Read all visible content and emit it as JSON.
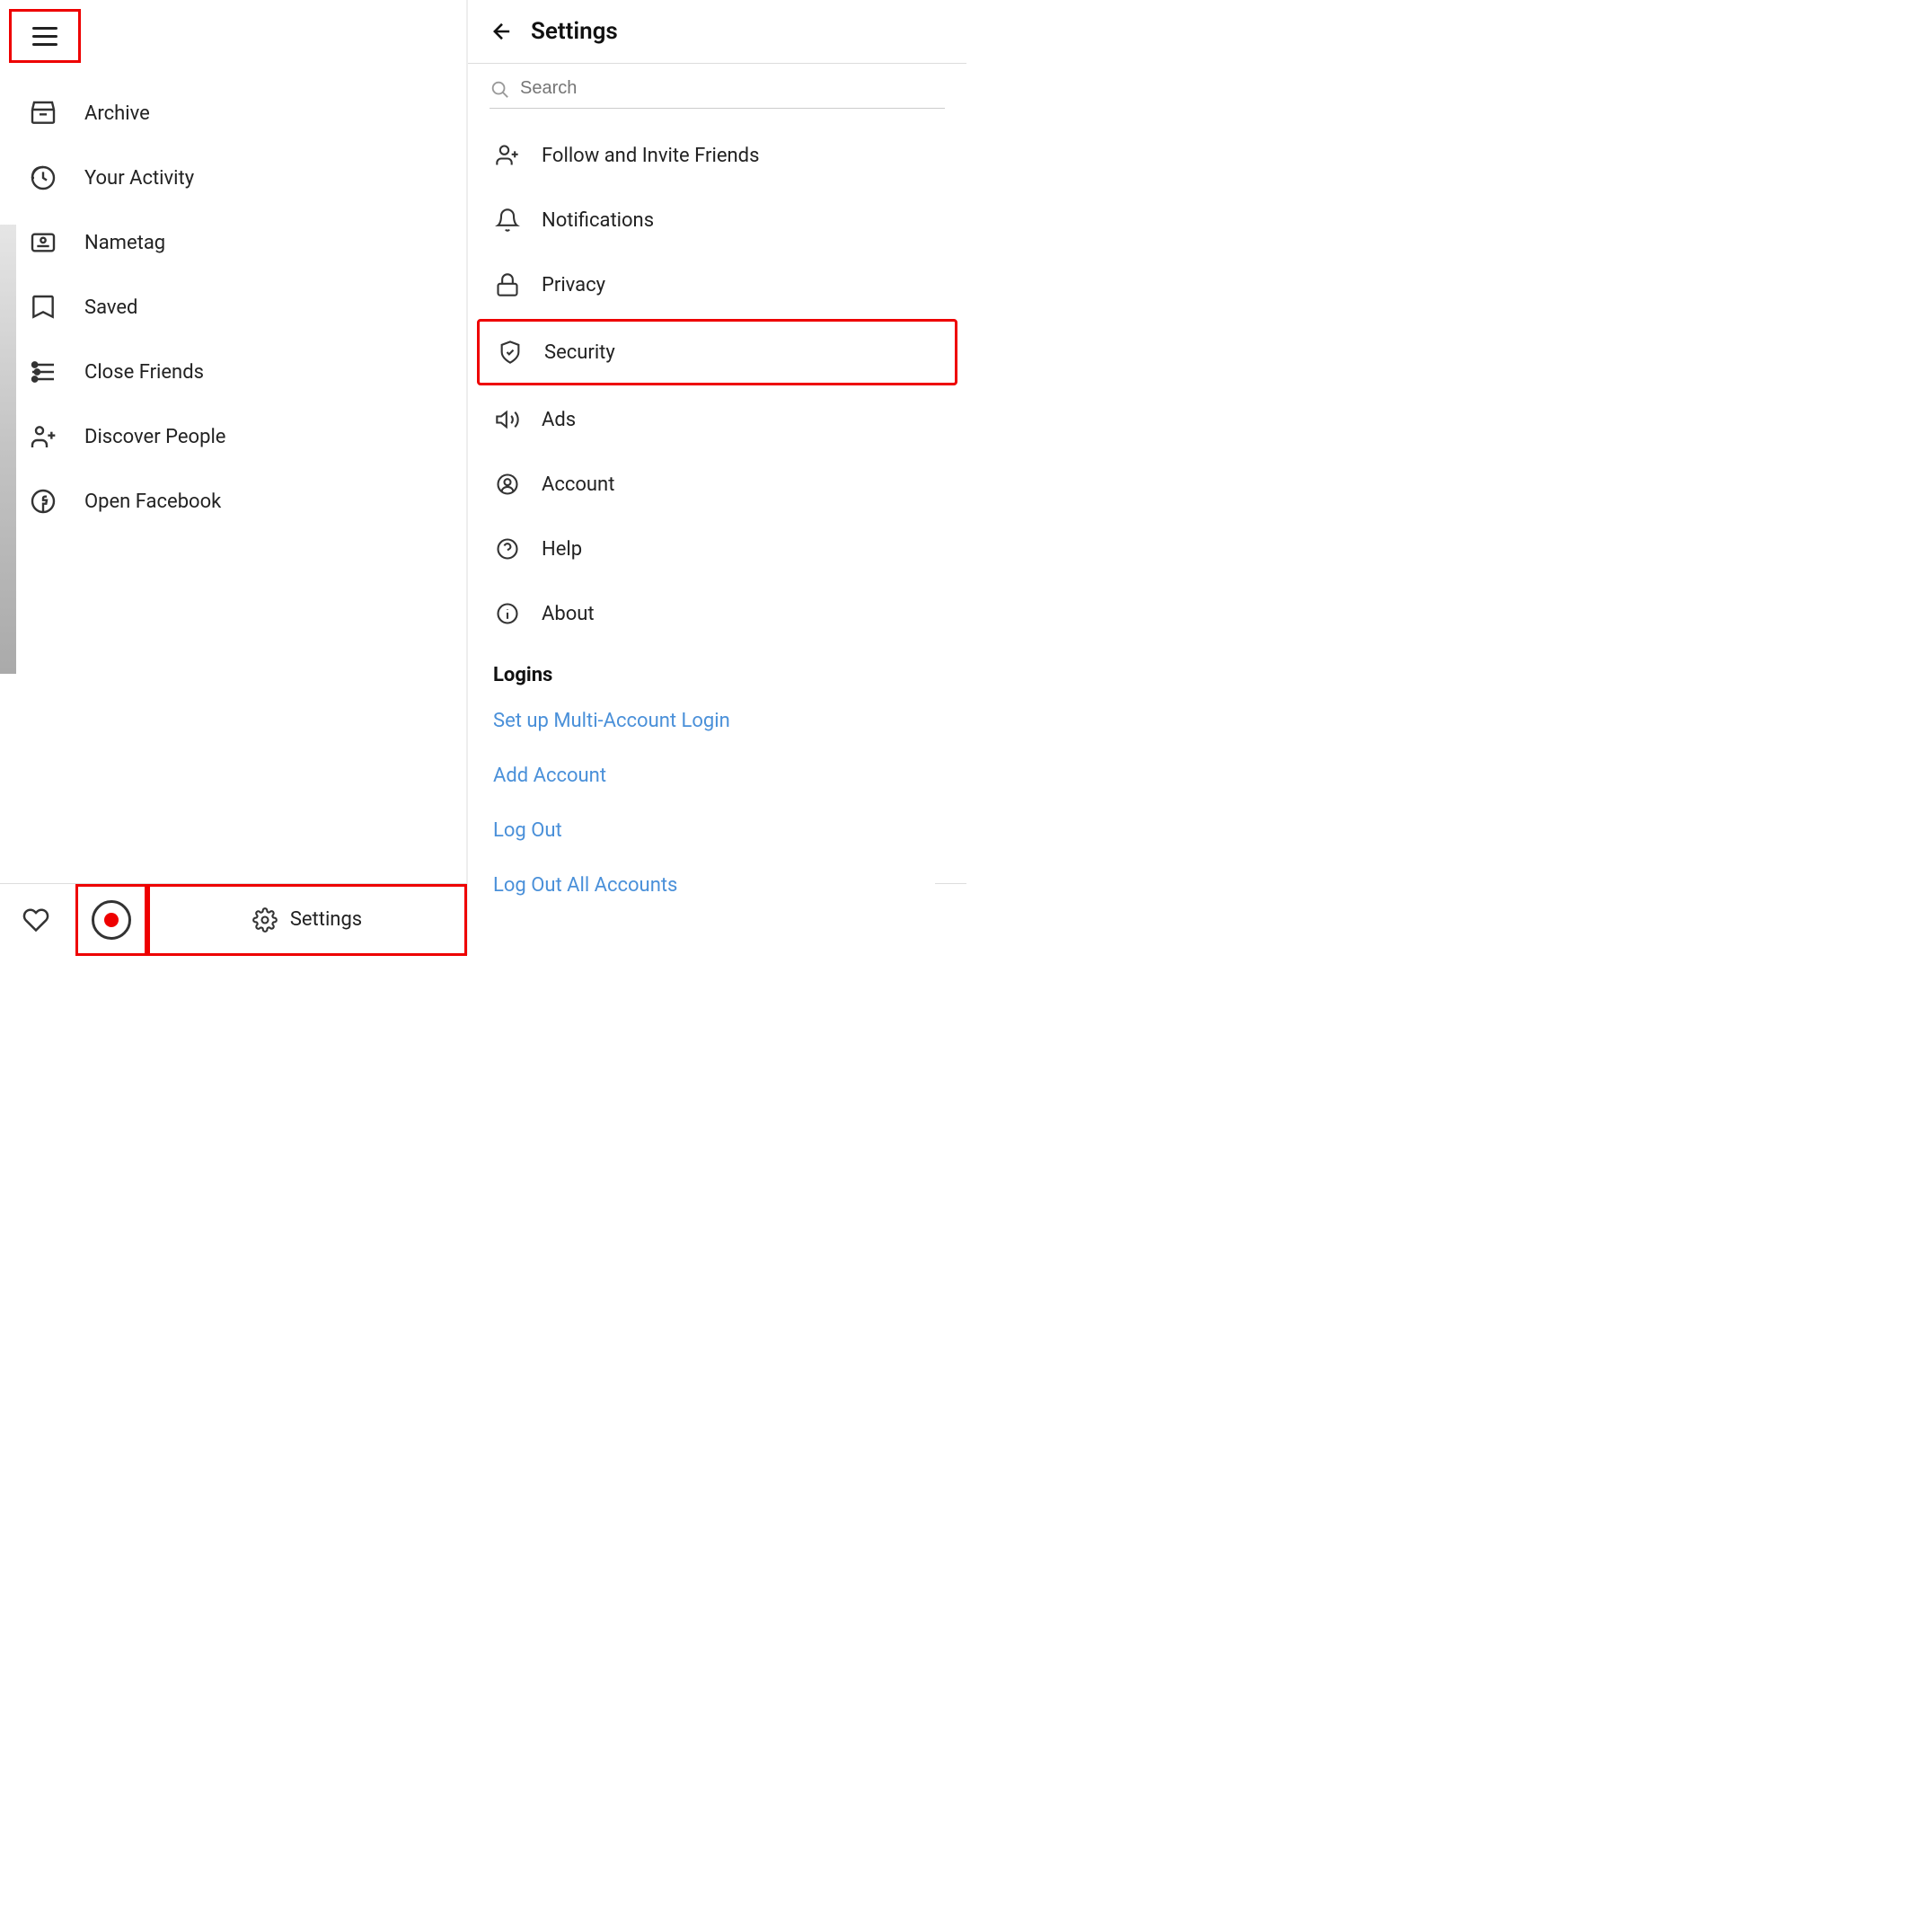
{
  "left_menu": {
    "items": [
      {
        "label": "Archive",
        "icon": "archive"
      },
      {
        "label": "Your Activity",
        "icon": "activity"
      },
      {
        "label": "Nametag",
        "icon": "nametag"
      },
      {
        "label": "Saved",
        "icon": "saved"
      },
      {
        "label": "Close Friends",
        "icon": "close-friends"
      },
      {
        "label": "Discover People",
        "icon": "discover"
      },
      {
        "label": "Open Facebook",
        "icon": "facebook"
      }
    ]
  },
  "bottom_left": {
    "settings_label": "Settings"
  },
  "settings": {
    "title": "Settings",
    "search_placeholder": "Search",
    "items": [
      {
        "label": "Follow and Invite Friends",
        "icon": "follow"
      },
      {
        "label": "Notifications",
        "icon": "bell"
      },
      {
        "label": "Privacy",
        "icon": "lock"
      },
      {
        "label": "Security",
        "icon": "shield"
      },
      {
        "label": "Ads",
        "icon": "ads"
      },
      {
        "label": "Account",
        "icon": "account"
      },
      {
        "label": "Help",
        "icon": "help"
      },
      {
        "label": "About",
        "icon": "info"
      }
    ],
    "logins_section": "Logins",
    "logins_links": [
      "Set up Multi-Account Login",
      "Add Account",
      "Log Out",
      "Log Out All Accounts"
    ]
  }
}
